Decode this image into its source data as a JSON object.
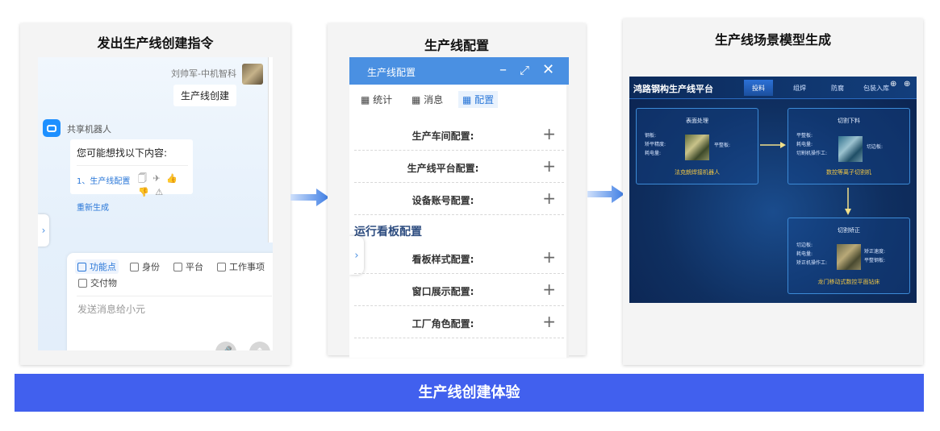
{
  "panel1": {
    "title": "发出生产线创建指令",
    "user_name": "刘帅军-中机智科",
    "user_message": "生产线创建",
    "bot_name": "共享机器人",
    "bot_question": "您可能想找以下内容:",
    "suggestion": "1、生产线配置",
    "action_icons": "🗍 ✈ 👍 👎 ⚠",
    "regenerate": "重新生成",
    "tools": [
      "功能点",
      "身份",
      "平台",
      "工作事项",
      "交付物"
    ],
    "input_placeholder": "发送消息给小元"
  },
  "panel2": {
    "title": "生产线配置",
    "window_title": "生产线配置",
    "tabs": [
      "统计",
      "消息",
      "配置"
    ],
    "rows_top": [
      "生产车间配置:",
      "生产线平台配置:",
      "设备账号配置:"
    ],
    "section": "运行看板配置",
    "rows_bottom": [
      "看板样式配置:",
      "窗口展示配置:",
      "工厂角色配置:"
    ]
  },
  "panel3": {
    "title": "生产线场景模型生成",
    "platform_title": "鸿路钢构生产线平台",
    "tabs": [
      "投料",
      "组焊",
      "防腐",
      "包装入库"
    ],
    "stations": [
      {
        "name": "表面处理",
        "fields": [
          "钢板:",
          "矫平精度:",
          "耗电量:"
        ],
        "extra": [
          "平整板:"
        ],
        "machine": "法克朗焊接机器人"
      },
      {
        "name": "切割下料",
        "fields": [
          "平整板:",
          "耗电量:",
          "切割机操作工:"
        ],
        "extra": [
          "切边板:"
        ],
        "machine": "数控等离子切割机"
      },
      {
        "name": "切割矫正",
        "fields": [
          "切边板:",
          "耗电量:",
          "矫正机操作工:"
        ],
        "extra": [
          "矫正速度:",
          "平整钢板:"
        ],
        "machine": "龙门移动式数控平面钻床"
      }
    ]
  },
  "banner": "生产线创建体验",
  "colors": {
    "accent": "#4160ee",
    "window_header": "#4a90e2",
    "link": "#2a77d8",
    "machine_label": "#f2c744"
  }
}
